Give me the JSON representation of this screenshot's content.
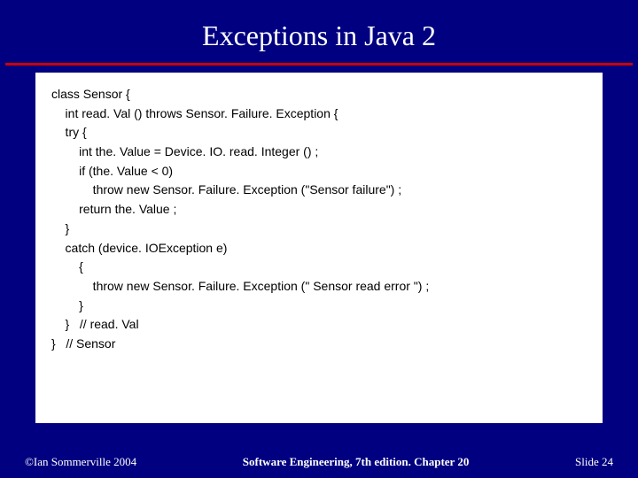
{
  "title": "Exceptions in Java 2",
  "code": {
    "lines": [
      "class Sensor {",
      "",
      "    int read. Val () throws Sensor. Failure. Exception {",
      "",
      "    try {",
      "        int the. Value = Device. IO. read. Integer () ;",
      "        if (the. Value < 0)",
      "            throw new Sensor. Failure. Exception (\"Sensor failure\") ;",
      "        return the. Value ;",
      "    }",
      "    catch (device. IOException e)",
      "        {",
      "            throw new Sensor. Failure. Exception (\" Sensor read error \") ;",
      "        }",
      "    }   // read. Val",
      "}   // Sensor"
    ]
  },
  "footer": {
    "left": "©Ian Sommerville 2004",
    "center": "Software Engineering, 7th edition. Chapter 20",
    "right": "Slide 24"
  }
}
